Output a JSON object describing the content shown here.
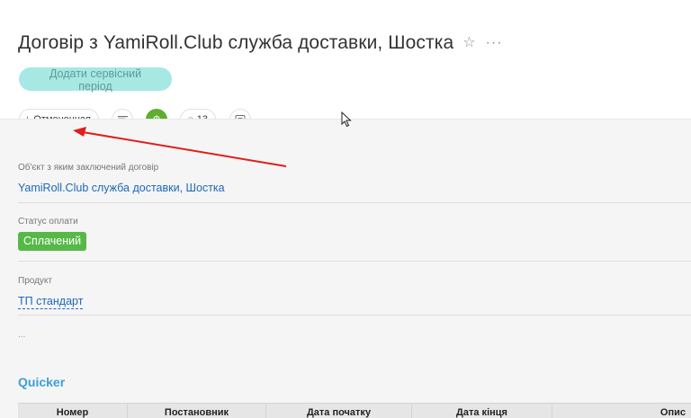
{
  "header": {
    "title": "Договір з YamiRoll.Club служба доставки, Шостка",
    "star_icon": "☆",
    "more_icon": "···",
    "service_button": "Додати сервісний період"
  },
  "toolbar": {
    "status": "Отмененная",
    "status_color": "#7a7e82",
    "green_button_glyph": "Ф",
    "green_color": "#5fae2e",
    "counter": "13"
  },
  "fields": {
    "object": {
      "label": "Об'єкт з яким заключений договір",
      "value": "YamiRoll.Club служба доставки, Шостка"
    },
    "payment": {
      "label": "Статус оплати",
      "value": "Сплачений",
      "badge_color": "#56b947"
    },
    "product": {
      "label": "Продукт",
      "value": "ТП стандарт"
    },
    "ellipsis": "..."
  },
  "section": {
    "title": "Quicker",
    "columns": [
      "Номер",
      "Постановник",
      "Дата початку",
      "Дата кінця",
      "Опис"
    ]
  },
  "annotation": {
    "arrow_color": "#e11d1d"
  }
}
